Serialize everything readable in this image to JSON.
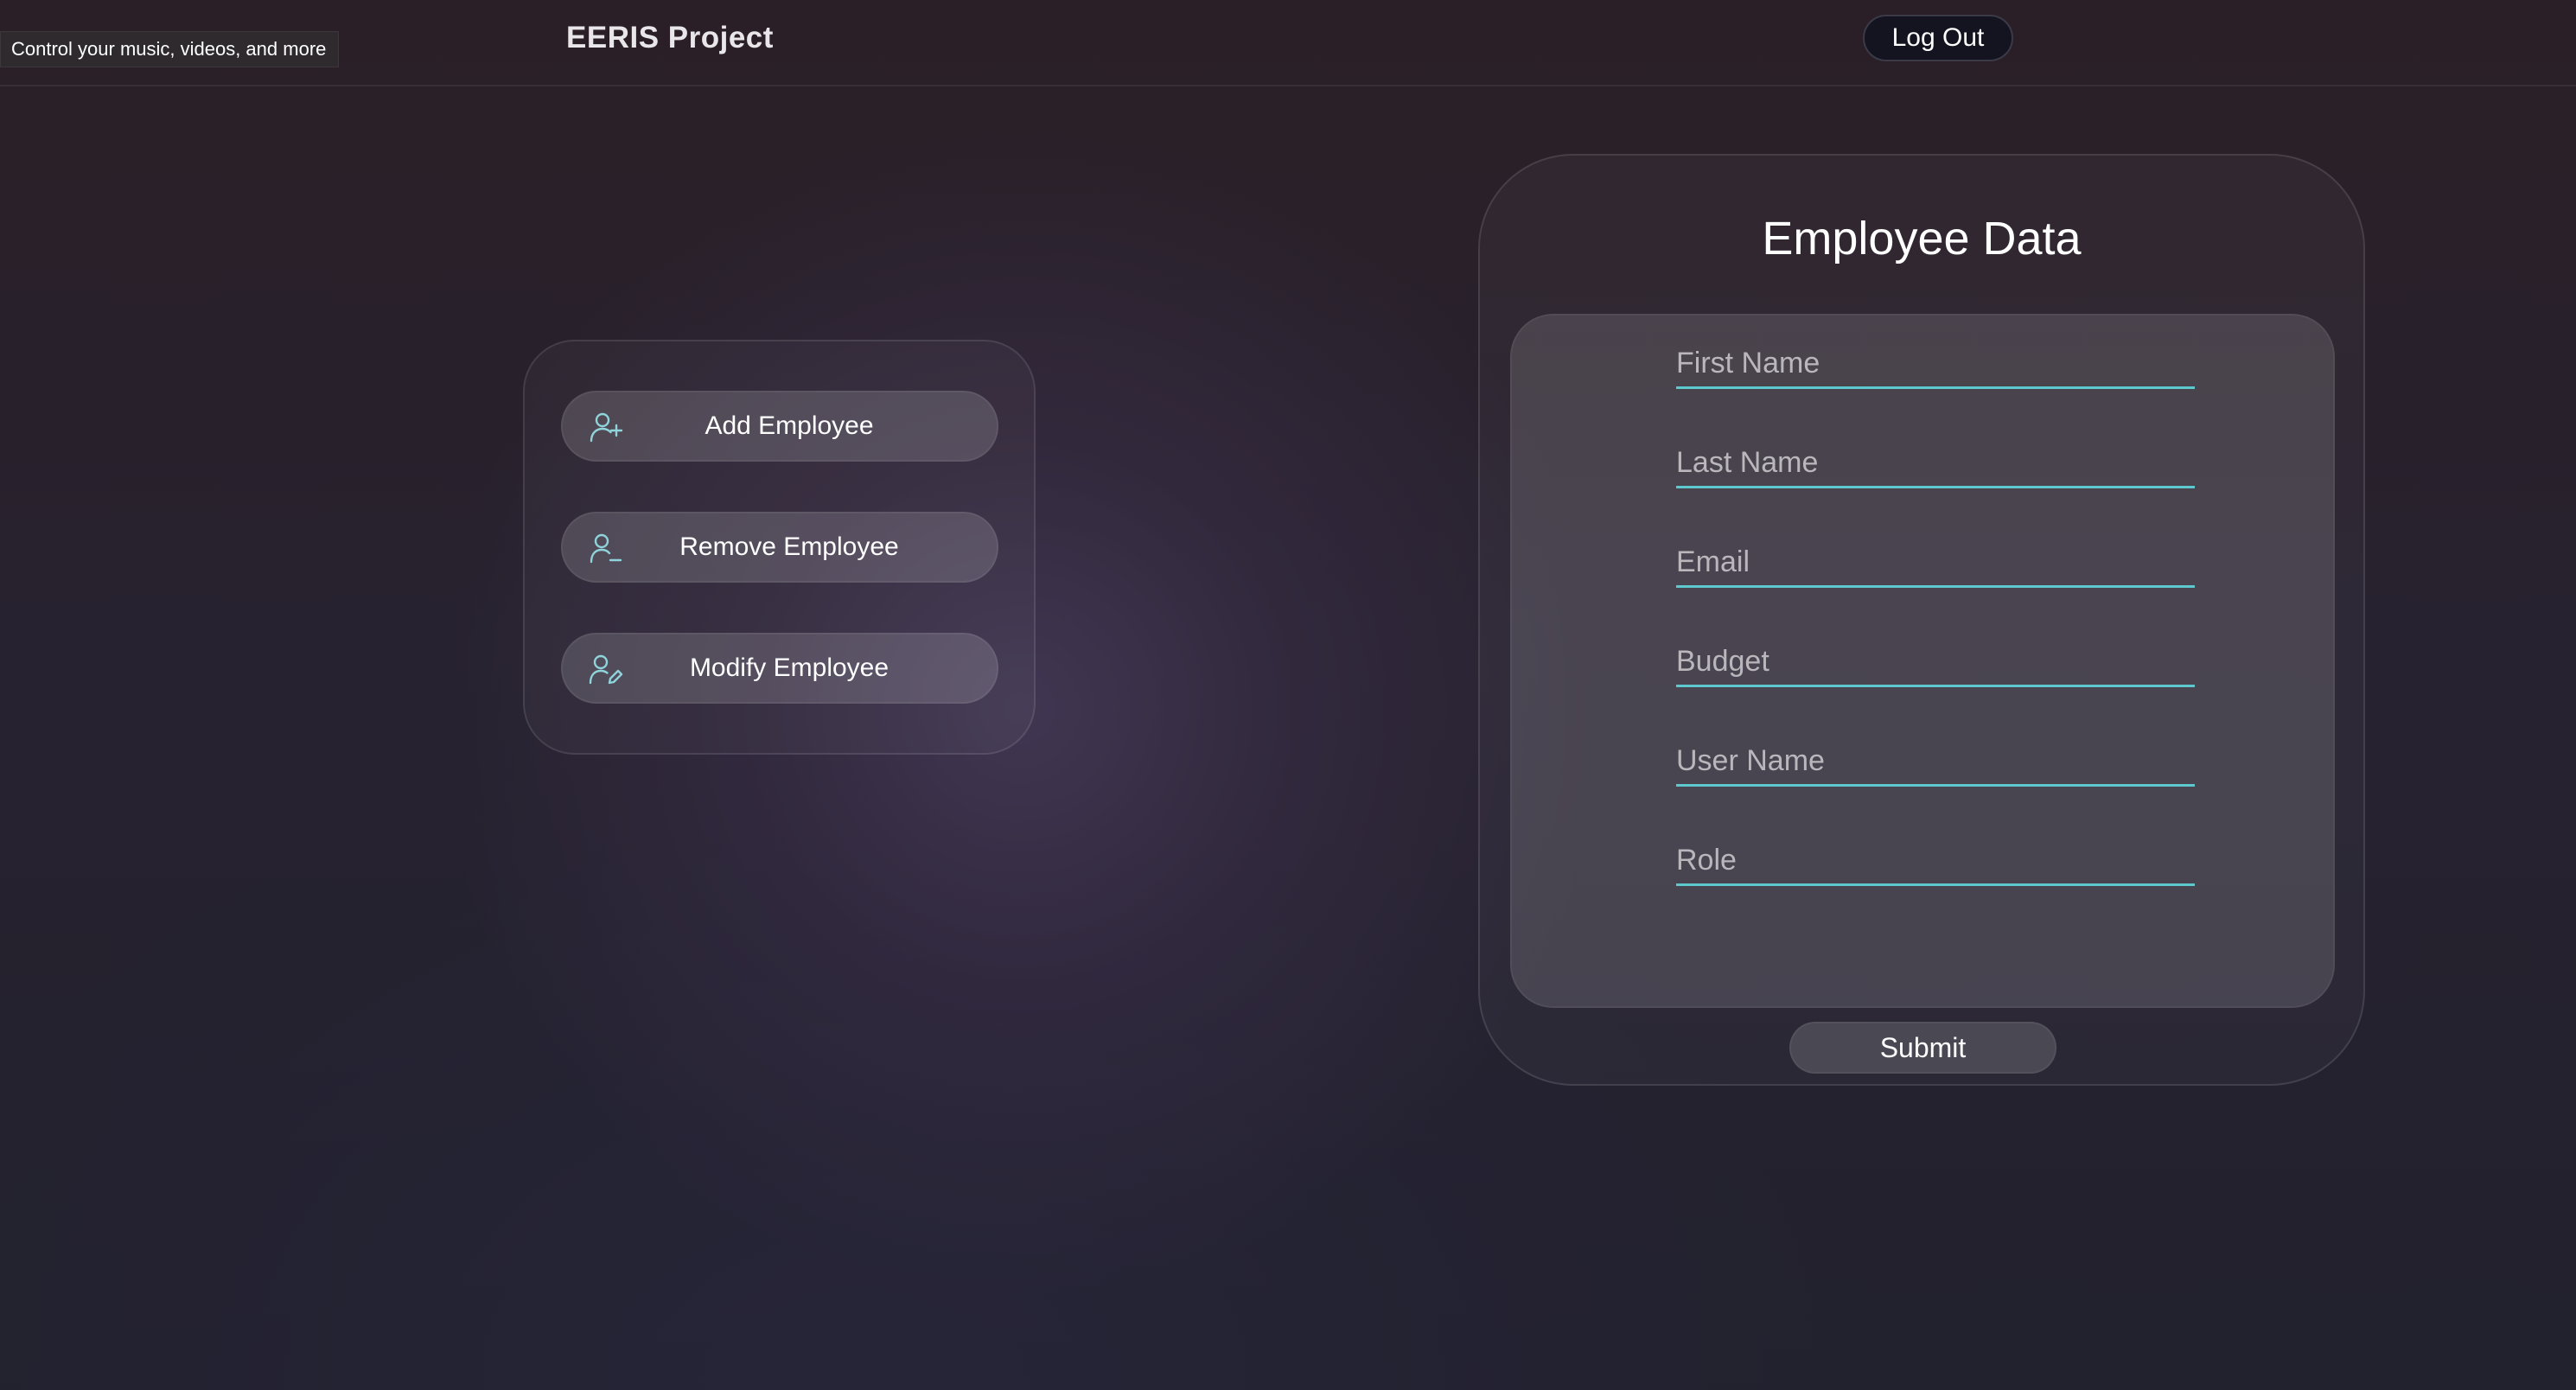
{
  "tooltip": {
    "text": "Control your music, videos, and more"
  },
  "header": {
    "brand": "EERIS Project",
    "logout_label": "Log Out"
  },
  "actions": [
    {
      "label": "Add Employee",
      "icon": "user-plus-icon"
    },
    {
      "label": "Remove Employee",
      "icon": "user-minus-icon"
    },
    {
      "label": "Modify Employee",
      "icon": "user-edit-icon"
    }
  ],
  "form": {
    "title": "Employee Data",
    "fields": [
      {
        "placeholder": "First Name",
        "value": ""
      },
      {
        "placeholder": "Last Name",
        "value": ""
      },
      {
        "placeholder": "Email",
        "value": ""
      },
      {
        "placeholder": "Budget",
        "value": ""
      },
      {
        "placeholder": "User Name",
        "value": ""
      },
      {
        "placeholder": "Role",
        "value": ""
      }
    ],
    "submit_label": "Submit"
  },
  "colors": {
    "accent": "#5ec8cf",
    "logout_bg": "#141420",
    "icon": "#8fd3db"
  }
}
